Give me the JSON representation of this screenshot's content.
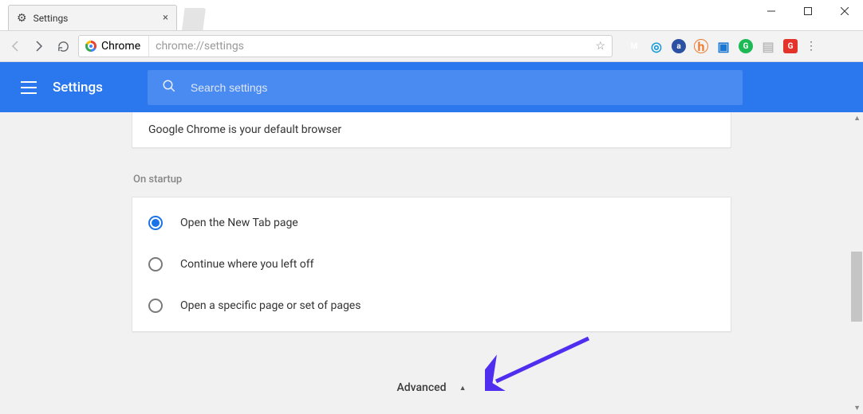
{
  "window": {
    "tab_title": "Settings"
  },
  "toolbar": {
    "chrome_label": "Chrome",
    "url": "chrome://settings"
  },
  "header": {
    "title": "Settings",
    "search_placeholder": "Search settings"
  },
  "default_browser_text": "Google Chrome is your default browser",
  "on_startup_label": "On startup",
  "startup_options": {
    "opt0": "Open the New Tab page",
    "opt1": "Continue where you left off",
    "opt2": "Open a specific page or set of pages"
  },
  "advanced_label": "Advanced",
  "ext_icons": {
    "i0": "M",
    "i1": "◎",
    "i2": "a",
    "i3": "h",
    "i4": "▣",
    "i5": "G",
    "i6": "▤",
    "i7": "G"
  },
  "ext_colors": {
    "c0": "#3a3a3a",
    "c1": "#169bd7",
    "c2": "#2b51a3",
    "c3": "#ef7b2f",
    "c4": "#1976d2",
    "c5": "#1db954",
    "c6": "#bcbcbc",
    "c7": "#e4332b"
  }
}
